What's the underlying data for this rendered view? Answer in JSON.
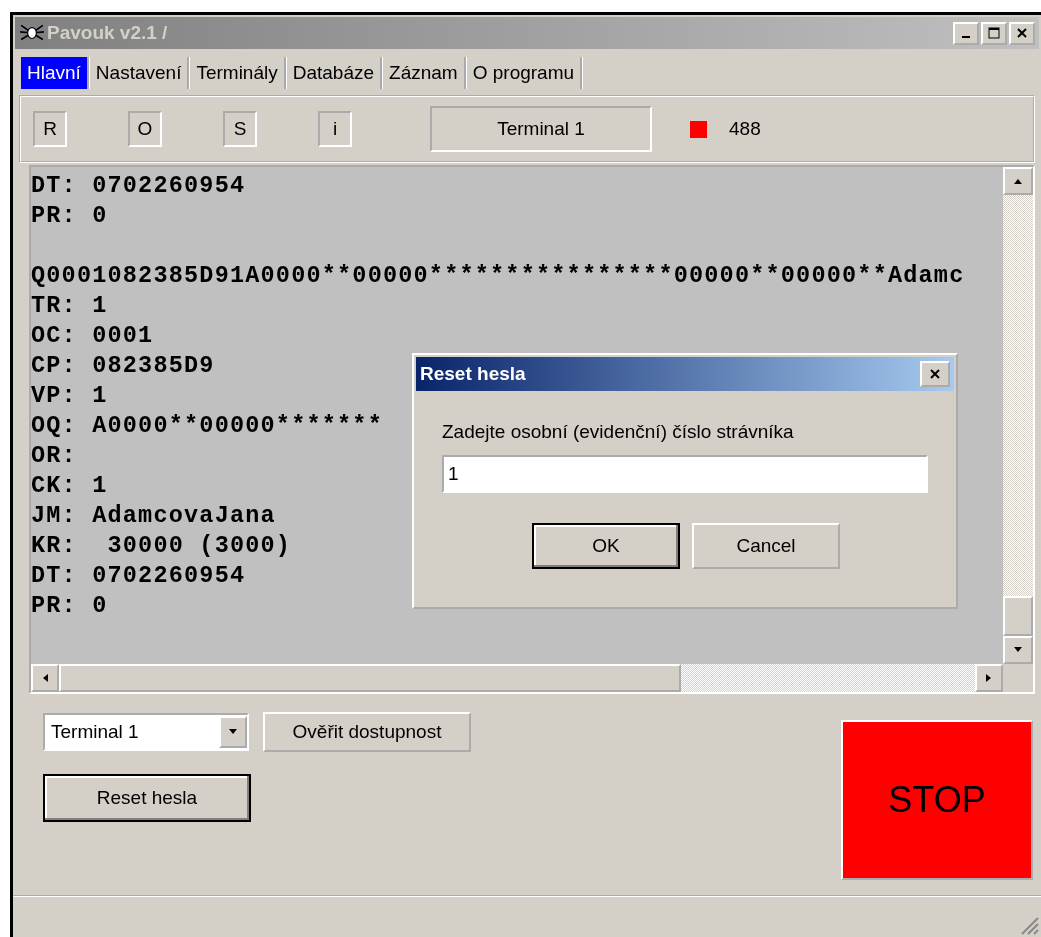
{
  "window": {
    "title": "Pavouk v2.1 /"
  },
  "tabs": [
    {
      "label": "Hlavní",
      "selected": true
    },
    {
      "label": "Nastavení",
      "selected": false
    },
    {
      "label": "Terminály",
      "selected": false
    },
    {
      "label": "Databáze",
      "selected": false
    },
    {
      "label": "Záznam",
      "selected": false
    },
    {
      "label": "O programu",
      "selected": false
    }
  ],
  "toolbar": {
    "buttons": [
      "R",
      "O",
      "S",
      "i"
    ],
    "terminal": "Terminal 1",
    "indicator": {
      "color": "#ff0000"
    },
    "count": "488"
  },
  "log": {
    "blocks": [
      [
        "DT: 0702260954",
        "PR: 0"
      ],
      [
        "Q0001082385D91A0000**00000****************00000**00000**Adamc",
        "TR: 1",
        "OC: 0001",
        "CP: 082385D9",
        "VP: 1",
        "OQ: A0000**00000*******",
        "OR:",
        "CK: 1",
        "JM: AdamcovaJana",
        "KR:  30000 (3000)",
        "DT: 0702260954",
        "PR: 0"
      ]
    ]
  },
  "controls": {
    "terminal_select": "Terminal 1",
    "check_button": "Ověřit dostupnost",
    "reset_button": "Reset hesla",
    "stop_button": "STOP"
  },
  "dialog": {
    "title": "Reset hesla",
    "prompt": "Zadejte osobní (evidenční) číslo strávníka",
    "value": "1",
    "buttons": [
      "OK",
      "Cancel"
    ]
  }
}
